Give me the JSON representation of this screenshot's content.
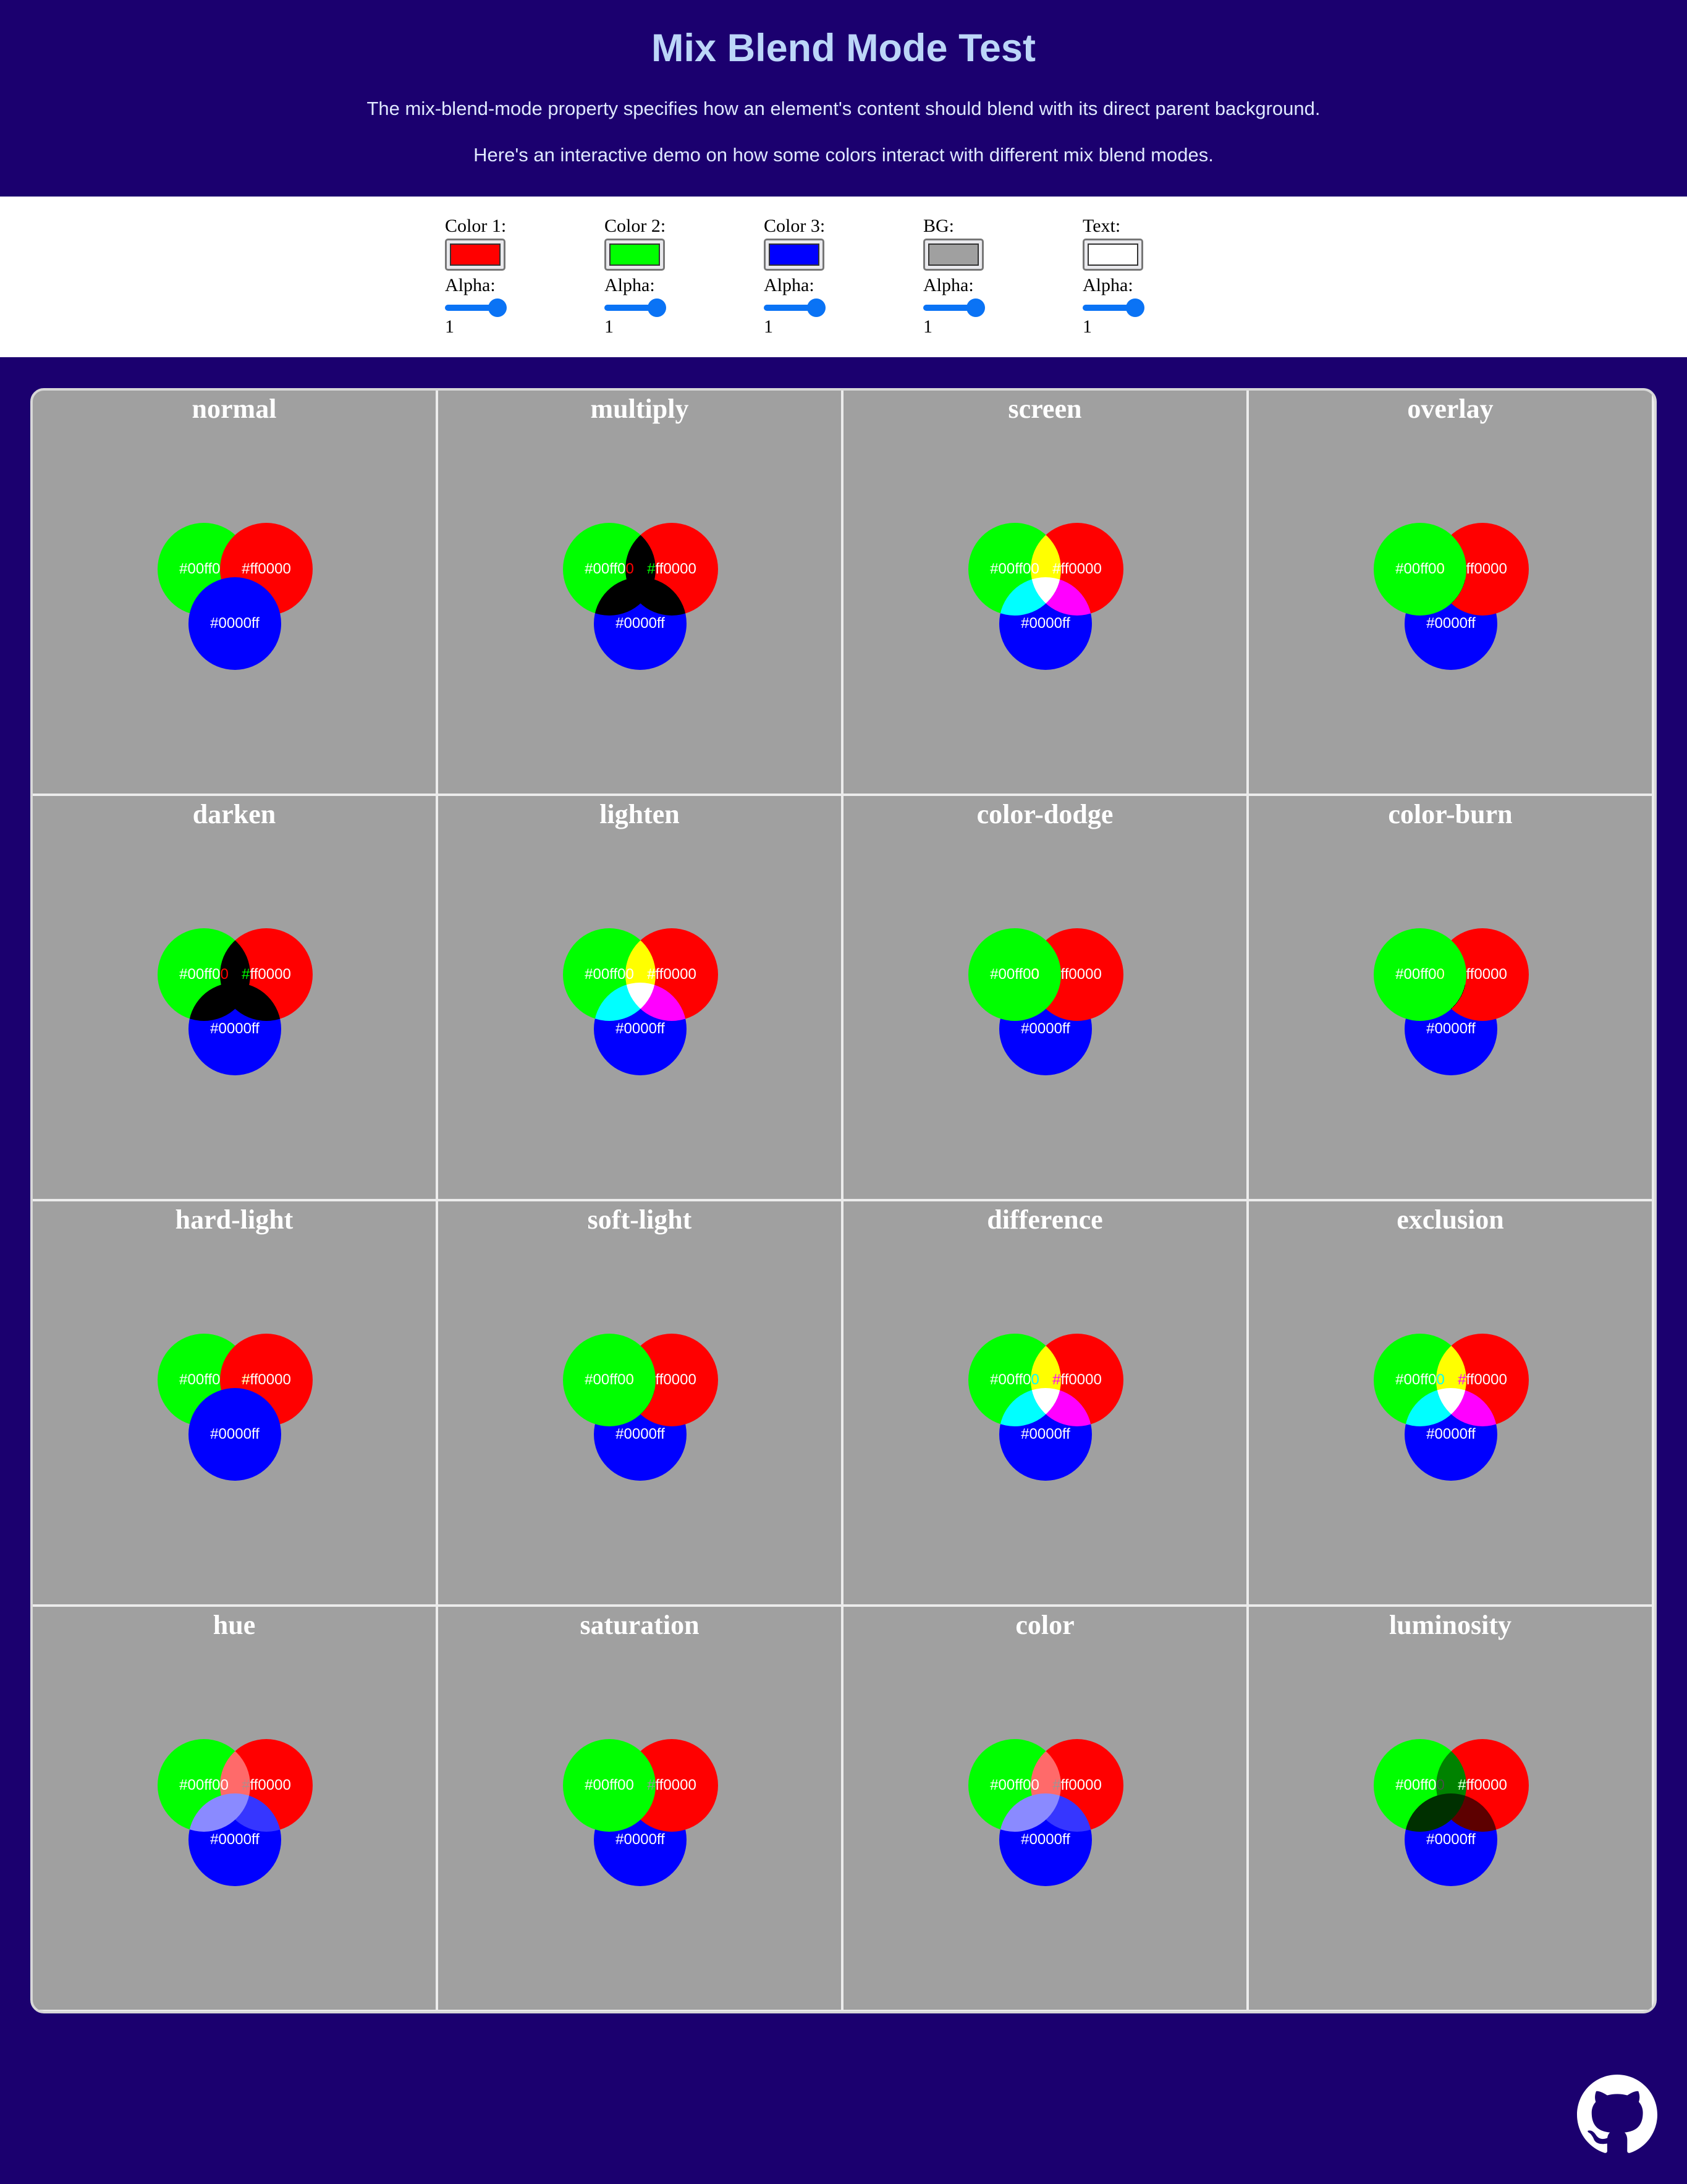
{
  "header": {
    "title": "Mix Blend Mode Test",
    "desc1": "The mix-blend-mode property specifies how an element's content should blend with its direct parent background.",
    "desc2": "Here's an interactive demo on how some colors interact with different mix blend modes."
  },
  "controls": [
    {
      "label": "Color 1:",
      "color": "#ff0000",
      "alpha_label": "Alpha:",
      "alpha": "1"
    },
    {
      "label": "Color 2:",
      "color": "#00ff00",
      "alpha_label": "Alpha:",
      "alpha": "1"
    },
    {
      "label": "Color 3:",
      "color": "#0000ff",
      "alpha_label": "Alpha:",
      "alpha": "1"
    },
    {
      "label": "BG:",
      "color": "#a0a0a0",
      "alpha_label": "Alpha:",
      "alpha": "1"
    },
    {
      "label": "Text:",
      "color": "#ffffff",
      "alpha_label": "Alpha:",
      "alpha": "1"
    }
  ],
  "circle_labels": {
    "green": "#00ff00",
    "red": "#ff0000",
    "blue": "#0000ff"
  },
  "modes": [
    "normal",
    "multiply",
    "screen",
    "overlay",
    "darken",
    "lighten",
    "color-dodge",
    "color-burn",
    "hard-light",
    "soft-light",
    "difference",
    "exclusion",
    "hue",
    "saturation",
    "color",
    "luminosity"
  ],
  "colors": {
    "background": "#1b006f",
    "grid_bg": "#a0a0a0",
    "slider": "#0a73f5"
  },
  "footer": {
    "icon": "github-icon"
  }
}
